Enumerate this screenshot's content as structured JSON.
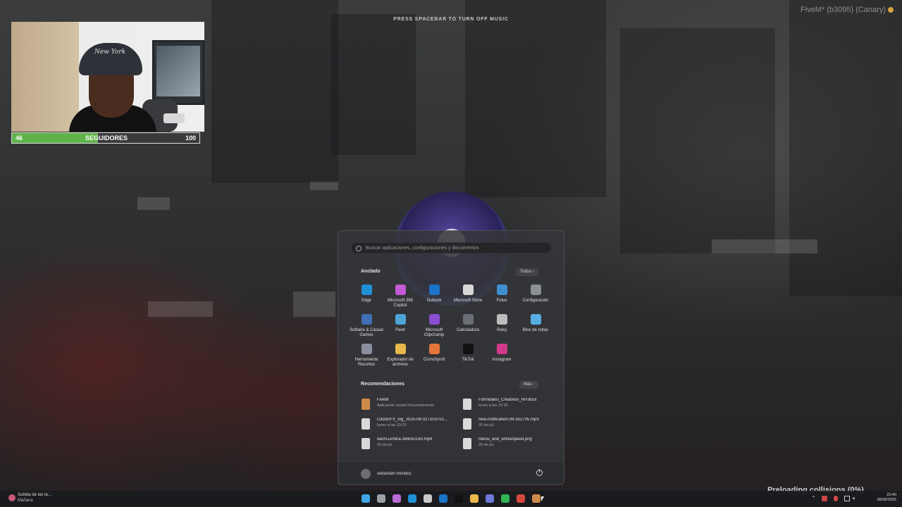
{
  "overlay": {
    "music_hint": "PRESS SPACEBAR TO TURN OFF MUSIC",
    "app_label": "FiveM* (b3095) (Canary)",
    "preload_status": "Preloading collisions (0%)"
  },
  "stream": {
    "cap_logo": "New York",
    "followers": {
      "label": "SEGUIDORES",
      "current": "46",
      "goal": "100",
      "progress": 0.46
    }
  },
  "start_menu": {
    "search_placeholder": "Buscar aplicaciones, configuraciones y documentos",
    "pinned_title": "Anclado",
    "all_button": "Todos  ›",
    "pinned": [
      {
        "label": "Edge",
        "icon": "edge-icon",
        "color": "#1f8fd6"
      },
      {
        "label": "Microsoft 365 Copilot",
        "icon": "copilot-icon",
        "color": "#c35ad6"
      },
      {
        "label": "Outlook",
        "icon": "outlook-icon",
        "color": "#1a73c8"
      },
      {
        "label": "Microsoft Store",
        "icon": "store-icon",
        "color": "#d8d8d8"
      },
      {
        "label": "Fotos",
        "icon": "photos-icon",
        "color": "#3f8fd0"
      },
      {
        "label": "Configuración",
        "icon": "settings-icon",
        "color": "#8c8f94"
      },
      {
        "label": "Solitaire & Casual Games",
        "icon": "solitaire-icon",
        "color": "#3f6fb5"
      },
      {
        "label": "Paint",
        "icon": "paint-icon",
        "color": "#4ea5d8"
      },
      {
        "label": "Microsoft Clipchamp",
        "icon": "clipchamp-icon",
        "color": "#8b4ed1"
      },
      {
        "label": "Calculadora",
        "icon": "calculator-icon",
        "color": "#6b6f75"
      },
      {
        "label": "Reloj",
        "icon": "clock-icon",
        "color": "#bdbdbd"
      },
      {
        "label": "Bloc de notas",
        "icon": "notepad-icon",
        "color": "#58aee0"
      },
      {
        "label": "Herramienta Recortes",
        "icon": "snipping-icon",
        "color": "#8a8fa0"
      },
      {
        "label": "Explorador de archivos",
        "icon": "folder-icon",
        "color": "#e8b84a"
      },
      {
        "label": "Crunchyroll",
        "icon": "crunchyroll-icon",
        "color": "#e5753a"
      },
      {
        "label": "TikTok",
        "icon": "tiktok-icon",
        "color": "#111111"
      },
      {
        "label": "Instagram",
        "icon": "instagram-icon",
        "color": "#d13a8a"
      }
    ],
    "rec_title": "Recomendaciones",
    "more_button": "Más  ›",
    "recommendations": [
      {
        "name": "FiveM",
        "sub": "Aplicación usada frecuentemente",
        "color": "#d08a4a"
      },
      {
        "name": "Formulario_Creativos_RP.docx",
        "sub": "lunes a las 23:33",
        "color": "#d9d9d9"
      },
      {
        "name": "CitizenFX_log_2025-08-02T203751...",
        "sub": "lunes a las 19:23",
        "color": "#d9d9d9"
      },
      {
        "name": "new-notification-09-352705.mp3",
        "sub": "20 de jul.",
        "color": "#d9d9d9"
      },
      {
        "name": "itachi-uchiha.3840x2160.mp4",
        "sub": "20 de jul.",
        "color": "#d9d9d9"
      },
      {
        "name": "messi_and_ishowspeed.png",
        "sub": "20 de jul.",
        "color": "#d9d9d9"
      }
    ],
    "user_name": "sebastian mendez"
  },
  "taskbar": {
    "weather_line1": "Subida de las te...",
    "weather_line2": "Mañana",
    "time": "23:40",
    "date": "08/08/2025",
    "apps": [
      {
        "icon": "start-icon",
        "color": "#3fa7e6"
      },
      {
        "icon": "task-view-icon",
        "color": "#9aa0a6"
      },
      {
        "icon": "copilot-icon",
        "color": "#b86ad6"
      },
      {
        "icon": "edge-icon",
        "color": "#1f8fd6"
      },
      {
        "icon": "store-icon",
        "color": "#c9c9c9"
      },
      {
        "icon": "outlook-icon",
        "color": "#1a73c8"
      },
      {
        "icon": "tiktok-icon",
        "color": "#111111"
      },
      {
        "icon": "folder-icon",
        "color": "#e8b84a"
      },
      {
        "icon": "discord-icon",
        "color": "#6e78d6"
      },
      {
        "icon": "spotify-icon",
        "color": "#2fb457"
      },
      {
        "icon": "chrome-icon",
        "color": "#d24a3c"
      },
      {
        "icon": "fivem-icon",
        "color": "#d08a4a"
      }
    ]
  }
}
